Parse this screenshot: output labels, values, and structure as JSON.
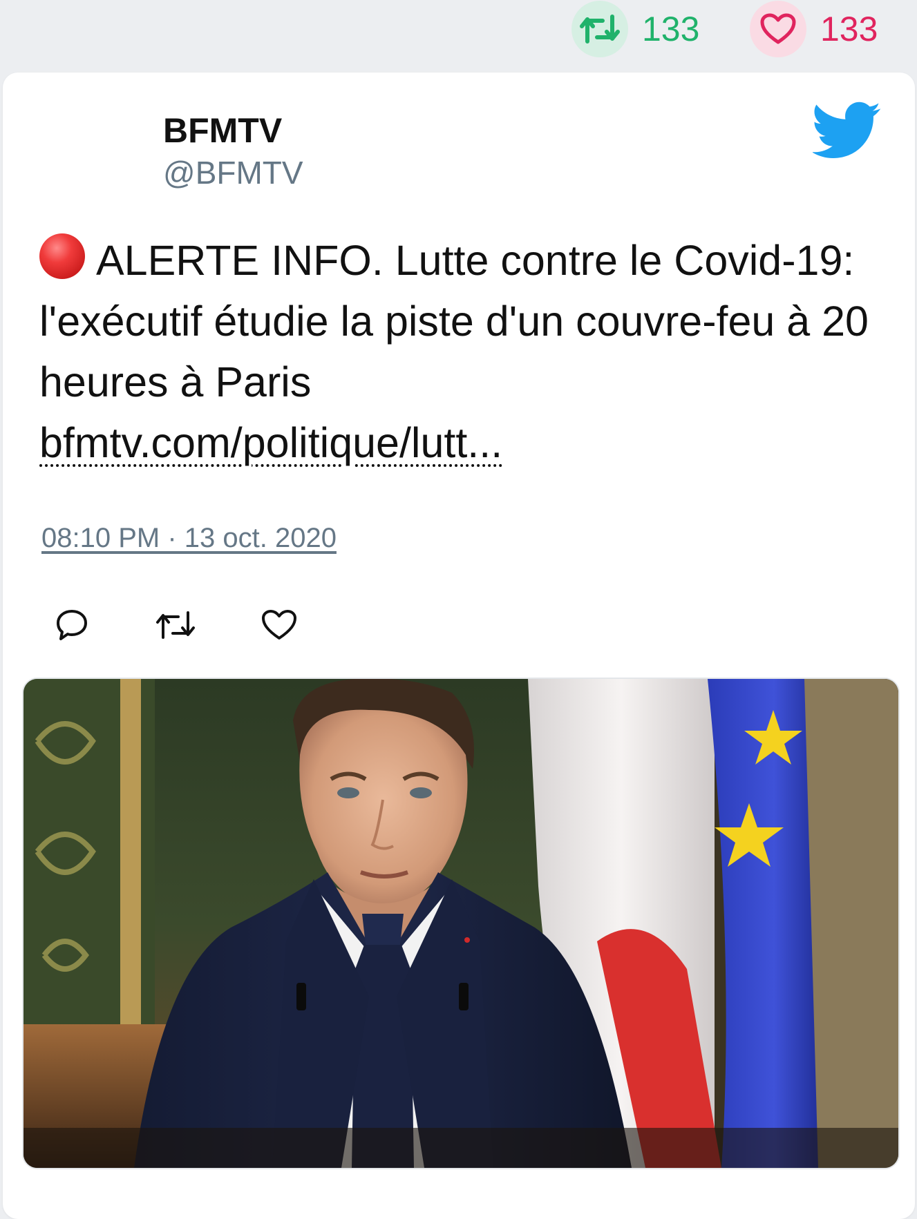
{
  "stats": {
    "retweet_count": "133",
    "like_count": "133",
    "retweet_color": "#20b26b",
    "like_color": "#e0245e"
  },
  "tweet": {
    "author_name": "BFMTV",
    "author_handle": "@BFMTV",
    "alert_icon": "red-circle-emoji",
    "text": "ALERTE INFO. Lutte contre le Covid-19: l'exécutif étudie la piste d'un couvre-feu à 20 heures à Paris",
    "link": "bfmtv.com/politique/lutt...",
    "timestamp": "08:10 PM · 13 oct. 2020"
  },
  "actions": {
    "reply_icon": "reply-icon",
    "retweet_icon": "retweet-icon",
    "like_icon": "heart-icon"
  },
  "brand": {
    "logo_icon": "twitter-bird-icon",
    "logo_color": "#1da1f2"
  },
  "media": {
    "kind": "photo"
  }
}
